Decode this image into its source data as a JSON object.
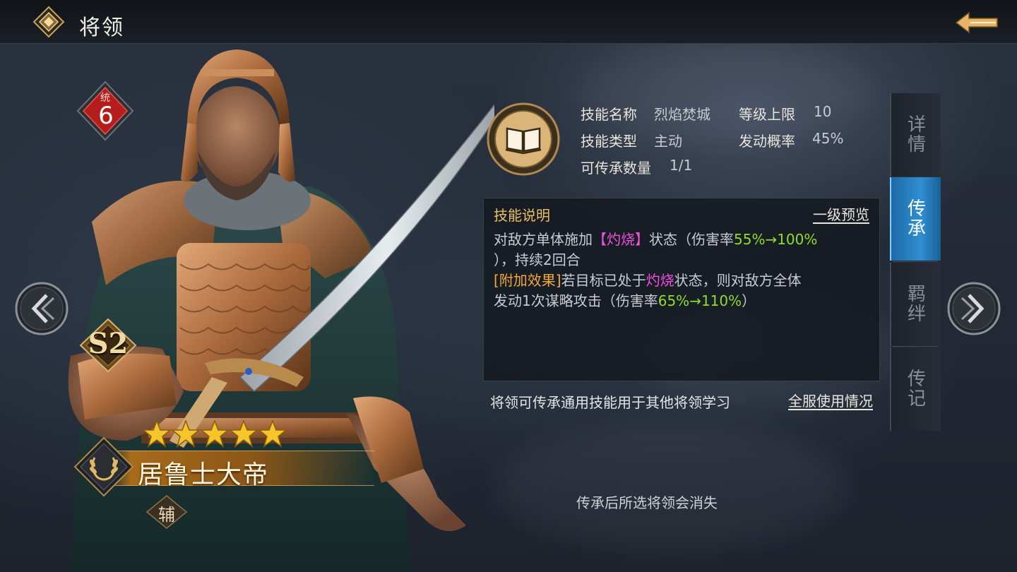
{
  "header": {
    "title": "将领"
  },
  "hero": {
    "stat_label": "统",
    "stat_value": "6",
    "grade": "S2",
    "stars": 5,
    "name": "居鲁士大帝",
    "role": "辅"
  },
  "skill": {
    "name_label": "技能名称",
    "name_value": "烈焰焚城",
    "level_cap_label": "等级上限",
    "level_cap_value": "10",
    "type_label": "技能类型",
    "type_value": "主动",
    "chance_label": "发动概率",
    "chance_value": "45%",
    "inherit_count_label": "可传承数量",
    "inherit_count_value": "1/1"
  },
  "description": {
    "title": "技能说明",
    "preview_link": "一级预览",
    "line1_a": "对敌方单体施加",
    "line1_status": "【灼烧】",
    "line1_b": "状态（伤害率",
    "line1_rate": "55%→100%",
    "line2": "），持续2回合",
    "line3_tag": "[附加效果]",
    "line3_a": "若目标已处于",
    "line3_status": "灼烧",
    "line3_b": "状态，则对敌方全体",
    "line4_a": "发动1次谋略攻击（伤害率",
    "line4_rate": "65%→110%",
    "line4_b": "）"
  },
  "notes": {
    "inherit_note": "将领可传承通用技能用于其他将领学习",
    "server_usage_link": "全服使用情况",
    "warning": "传承后所选将领会消失"
  },
  "tabs": [
    {
      "label_top": "详",
      "label_bottom": "情",
      "active": false
    },
    {
      "label_top": "传",
      "label_bottom": "承",
      "active": true
    },
    {
      "label_top": "羁",
      "label_bottom": "绊",
      "active": false
    },
    {
      "label_top": "传",
      "label_bottom": "记",
      "active": false
    }
  ],
  "colors": {
    "accent_blue": "#2f8fd2",
    "status_pink": "#f04fe0",
    "rate_green": "#8fdc2a",
    "effect_orange": "#f2a83a",
    "gold": "#e8c066"
  }
}
